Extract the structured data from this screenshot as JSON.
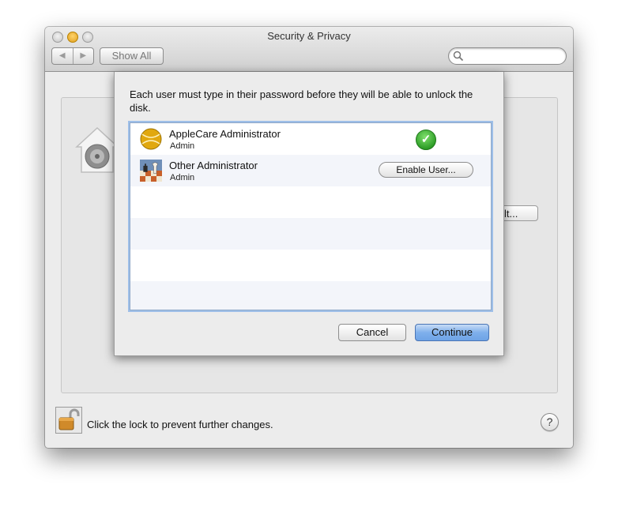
{
  "window": {
    "title": "Security & Privacy"
  },
  "toolbar": {
    "back_glyph": "◀",
    "forward_glyph": "▶",
    "show_all_label": "Show All",
    "search_placeholder": "",
    "search_icon": "magnifier-icon"
  },
  "panel": {
    "behind_button_label": "lt..."
  },
  "sheet": {
    "message": "Each user must type in their password before they will be able to unlock the disk.",
    "users": [
      {
        "name": "AppleCare Administrator",
        "role": "Admin",
        "avatar": "tennis-ball-avatar",
        "status": "enabled",
        "status_icon": "checkmark-icon"
      },
      {
        "name": "Other Administrator",
        "role": "Admin",
        "avatar": "chess-avatar",
        "status": "not-enabled",
        "action_label": "Enable User..."
      }
    ],
    "cancel_label": "Cancel",
    "continue_label": "Continue"
  },
  "footer": {
    "lock_text": "Click the lock to prevent further changes.",
    "help_label": "?"
  },
  "colors": {
    "accent_blue": "#7fb0ec",
    "check_green": "#2f9e28",
    "selection_ring": "#9ebfe8"
  }
}
